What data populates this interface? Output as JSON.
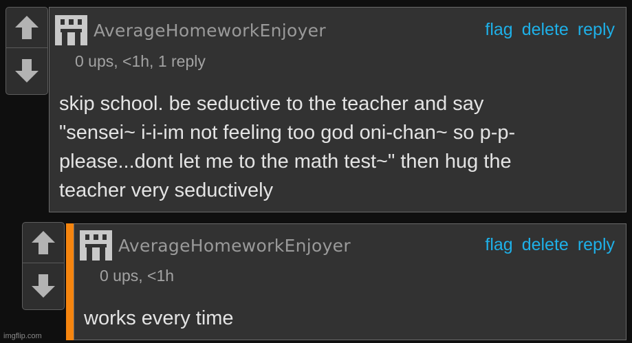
{
  "comments": [
    {
      "username": "AverageHomeworkEnjoyer",
      "meta": "0 ups, <1h, 1 reply",
      "actions": {
        "flag": "flag",
        "delete": "delete",
        "reply": "reply"
      },
      "text": "skip school. be seductive to the teacher and say\n\"sensei~ i-i-im not feeling too god oni-chan~ so p-p-\nplease...dont let me to the math test~\" then hug the\nteacher very seductively",
      "avatar_icon": "castle-icon",
      "vote_icons": [
        "upvote-arrow-icon",
        "downvote-arrow-icon"
      ]
    },
    {
      "username": "AverageHomeworkEnjoyer",
      "meta": "0 ups, <1h",
      "actions": {
        "flag": "flag",
        "delete": "delete",
        "reply": "reply"
      },
      "text": "works every time",
      "avatar_icon": "castle-icon",
      "vote_icons": [
        "upvote-arrow-icon",
        "downvote-arrow-icon"
      ],
      "is_reply": true
    }
  ],
  "watermark": "imgflip.com",
  "colors": {
    "background": "#0f0f0f",
    "panel": "#323232",
    "link": "#1eb0e8",
    "reply_accent": "#f6850f",
    "username": "#9a9a9a",
    "body_text": "#e4e4e4"
  }
}
